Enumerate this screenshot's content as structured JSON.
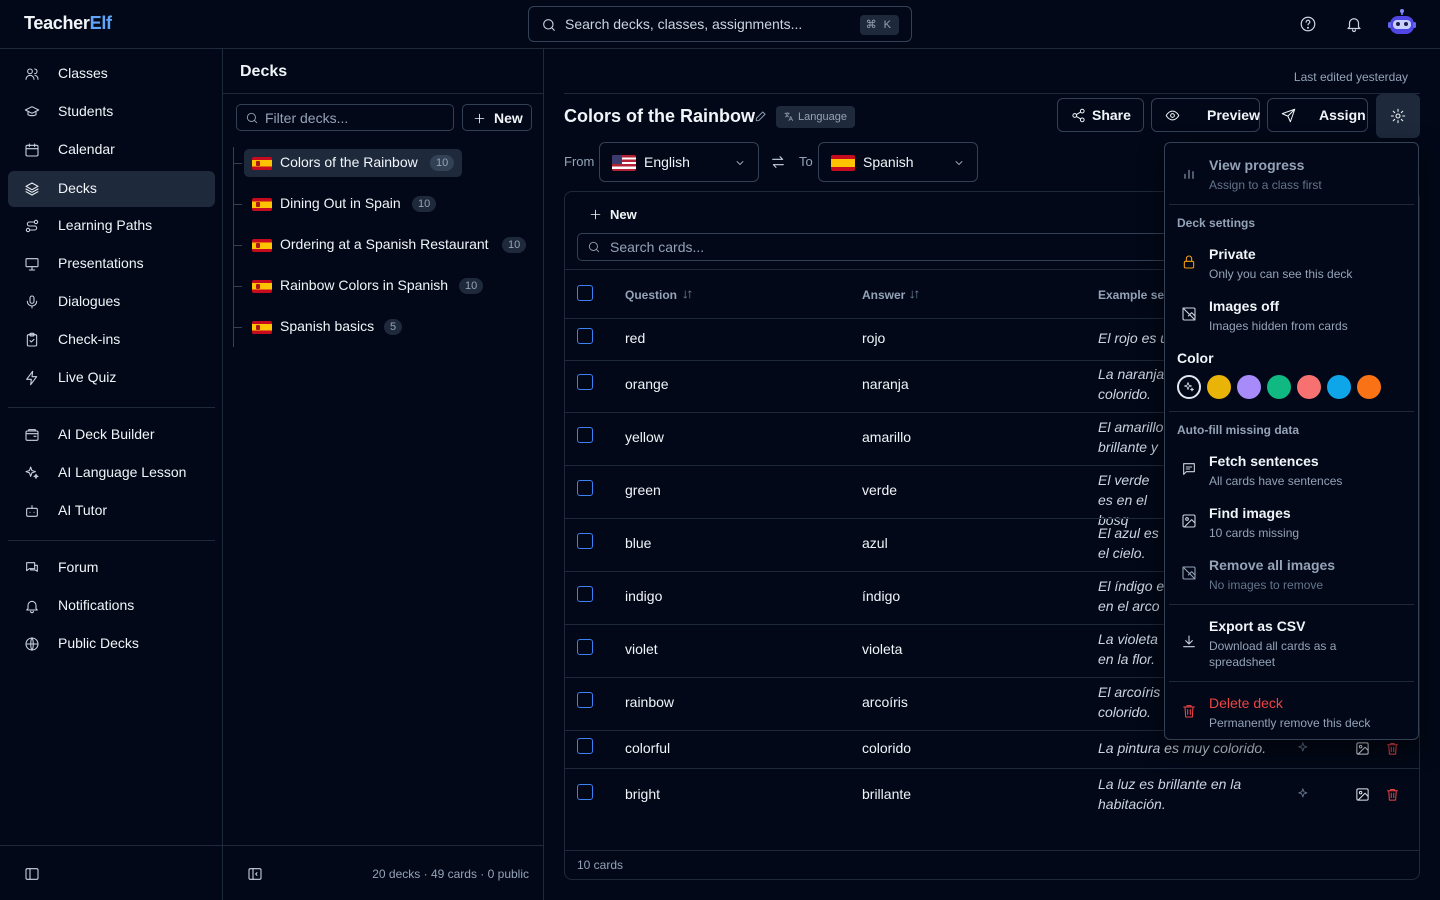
{
  "app": {
    "name_a": "Teacher",
    "name_b": "Elf"
  },
  "search": {
    "placeholder": "Search decks, classes, assignments...",
    "shortcut": "⌘ K"
  },
  "sidebar": {
    "items": [
      {
        "label": "Classes",
        "icon": "users-icon"
      },
      {
        "label": "Students",
        "icon": "graduation-cap-icon"
      },
      {
        "label": "Calendar",
        "icon": "calendar-icon"
      },
      {
        "label": "Decks",
        "icon": "layers-icon",
        "active": true
      },
      {
        "label": "Learning Paths",
        "icon": "route-icon"
      },
      {
        "label": "Presentations",
        "icon": "presentation-icon"
      },
      {
        "label": "Dialogues",
        "icon": "microphone-icon"
      },
      {
        "label": "Check-ins",
        "icon": "clipboard-check-icon"
      },
      {
        "label": "Live Quiz",
        "icon": "zap-icon"
      }
    ],
    "ai_items": [
      {
        "label": "AI Deck Builder",
        "icon": "wallet-cards-icon"
      },
      {
        "label": "AI Language Lesson",
        "icon": "sparkles-icon"
      },
      {
        "label": "AI Tutor",
        "icon": "bot-icon"
      }
    ],
    "community_items": [
      {
        "label": "Forum",
        "icon": "messages-icon"
      },
      {
        "label": "Notifications",
        "icon": "bell-icon"
      },
      {
        "label": "Public Decks",
        "icon": "globe-icon"
      }
    ]
  },
  "decks_panel": {
    "title": "Decks",
    "filter_placeholder": "Filter decks...",
    "new_label": "New",
    "decks": [
      {
        "name": "Colors of the Rainbow",
        "count": "10",
        "active": true
      },
      {
        "name": "Dining Out in Spain",
        "count": "10"
      },
      {
        "name": "Ordering at a Spanish Restaurant",
        "count": "10"
      },
      {
        "name": "Rainbow Colors in Spanish",
        "count": "10"
      },
      {
        "name": "Spanish basics",
        "count": "5"
      }
    ],
    "footer": "20 decks · 49 cards · 0 public"
  },
  "deck": {
    "last_edited": "Last edited yesterday",
    "title": "Colors of the Rainbow",
    "badge": "Language",
    "buttons": {
      "share": "Share",
      "preview": "Preview",
      "assign": "Assign"
    },
    "from_label": "From",
    "to_label": "To",
    "from_lang": "English",
    "to_lang": "Spanish"
  },
  "table": {
    "new_label": "New",
    "search_placeholder": "Search cards...",
    "columns": {
      "question": "Question",
      "answer": "Answer",
      "example": "Example se"
    },
    "rows": [
      {
        "q": "red",
        "a": "rojo",
        "ex": "El rojo es u"
      },
      {
        "q": "orange",
        "a": "naranja",
        "ex": "La naranja colorido."
      },
      {
        "q": "yellow",
        "a": "amarillo",
        "ex": "El amarillo brillante y"
      },
      {
        "q": "green",
        "a": "verde",
        "ex": "El verde es en el bosq"
      },
      {
        "q": "blue",
        "a": "azul",
        "ex": "El azul es el cielo."
      },
      {
        "q": "indigo",
        "a": "índigo",
        "ex": "El índigo e en el arco"
      },
      {
        "q": "violet",
        "a": "violeta",
        "ex": "La violeta en la flor."
      },
      {
        "q": "rainbow",
        "a": "arcoíris",
        "ex": "El arcoíris colorido."
      },
      {
        "q": "colorful",
        "a": "colorido",
        "ex": "La pintura es muy colorido."
      },
      {
        "q": "bright",
        "a": "brillante",
        "ex": "La luz es brillante en la habitación."
      }
    ],
    "footer": "10 cards"
  },
  "menu": {
    "view_progress": {
      "title": "View progress",
      "sub": "Assign to a class first"
    },
    "deck_settings_heading": "Deck settings",
    "private": {
      "title": "Private",
      "sub": "Only you can see this deck"
    },
    "images_off": {
      "title": "Images off",
      "sub": "Images hidden from cards"
    },
    "color_label": "Color",
    "colors": [
      "#eab308",
      "#a78bfa",
      "#10b981",
      "#f87171",
      "#0ea5e9",
      "#f97316"
    ],
    "autofill_heading": "Auto-fill missing data",
    "fetch_sentences": {
      "title": "Fetch sentences",
      "sub": "All cards have sentences"
    },
    "find_images": {
      "title": "Find images",
      "sub": "10 cards missing"
    },
    "remove_images": {
      "title": "Remove all images",
      "sub": "No images to remove"
    },
    "export_csv": {
      "title": "Export as CSV",
      "sub": "Download all cards as a spreadsheet"
    },
    "delete_deck": {
      "title": "Delete deck",
      "sub": "Permanently remove this deck"
    }
  },
  "colors": {
    "accent": "#60a5fa",
    "danger": "#ef4444",
    "private_lock": "#f59e0b"
  }
}
